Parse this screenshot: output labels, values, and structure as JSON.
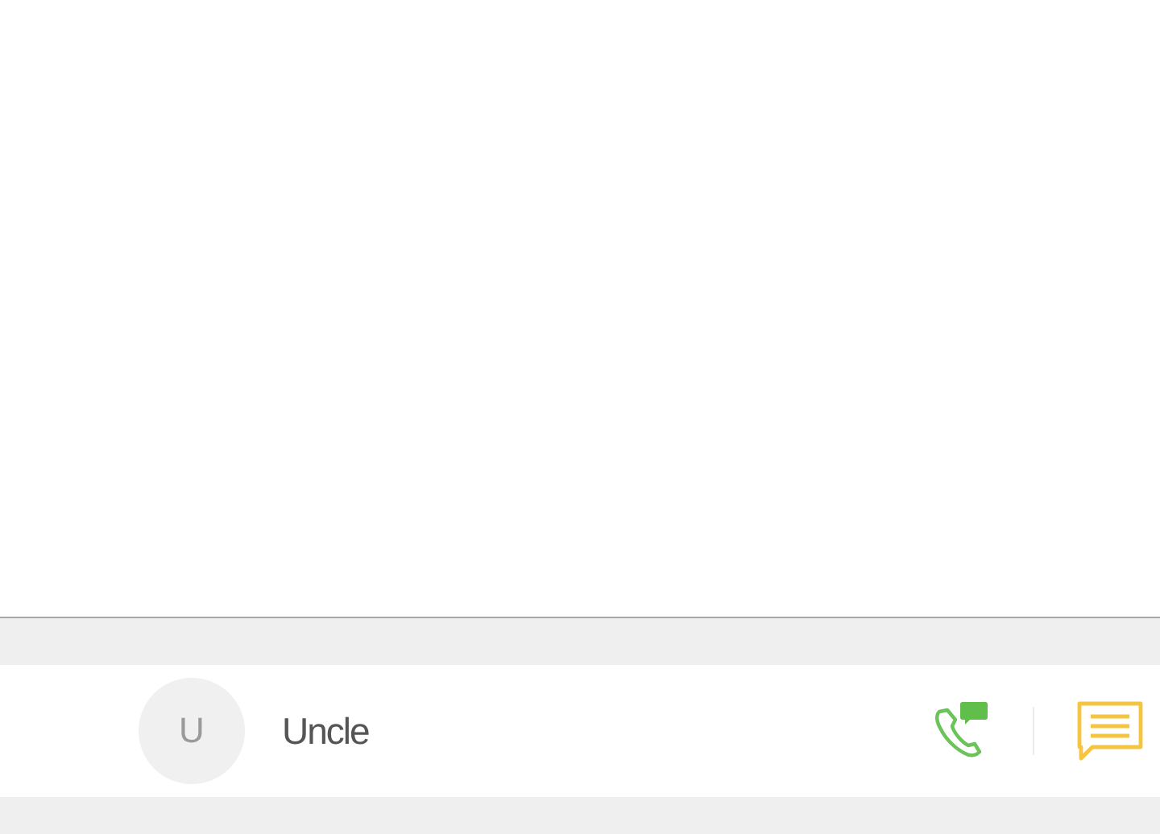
{
  "contacts": [
    {
      "initial": "U",
      "name": "Uncle"
    }
  ]
}
